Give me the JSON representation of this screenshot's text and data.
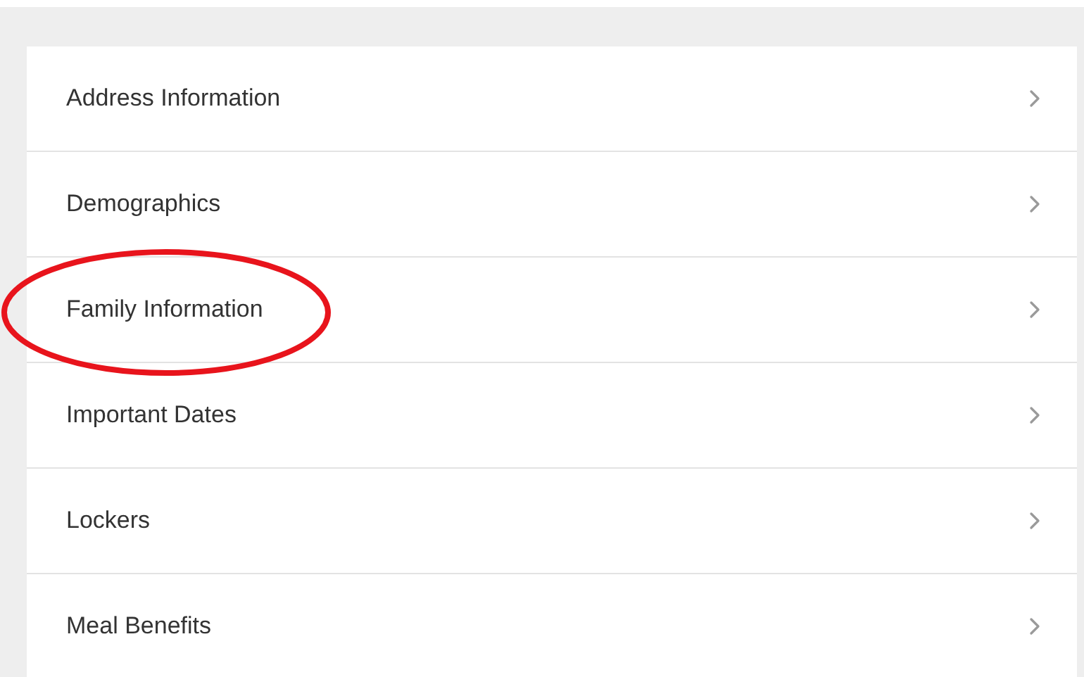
{
  "items": [
    {
      "label": "Address Information",
      "circled": false
    },
    {
      "label": "Demographics",
      "circled": false
    },
    {
      "label": "Family Information",
      "circled": true
    },
    {
      "label": "Important Dates",
      "circled": false
    },
    {
      "label": "Lockers",
      "circled": false
    },
    {
      "label": "Meal Benefits",
      "circled": false
    }
  ]
}
